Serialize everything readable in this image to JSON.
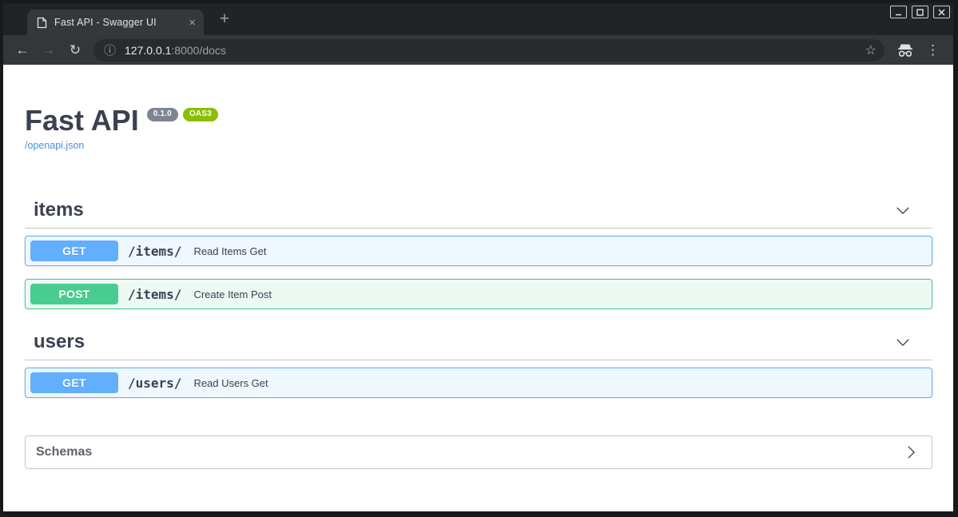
{
  "window": {
    "title_bar": {
      "tab": {
        "title": "Fast API - Swagger UI",
        "close_glyph": "×"
      },
      "new_tab_glyph": "+"
    },
    "toolbar": {
      "back_glyph": "←",
      "forward_glyph": "→",
      "reload_glyph": "↻",
      "omnibox": {
        "info_glyph": "ⓘ",
        "url_host": "127.0.0.1",
        "url_rest": ":8000/docs",
        "star_glyph": "☆"
      },
      "menu_glyph": "⋮"
    }
  },
  "api": {
    "title": "Fast API",
    "version_badge": "0.1.0",
    "oas_badge": "OAS3",
    "spec_link": "/openapi.json",
    "sections": [
      {
        "name": "items",
        "operations": [
          {
            "method": "GET",
            "path": "/items/",
            "summary": "Read Items Get"
          },
          {
            "method": "POST",
            "path": "/items/",
            "summary": "Create Item Post"
          }
        ]
      },
      {
        "name": "users",
        "operations": [
          {
            "method": "GET",
            "path": "/users/",
            "summary": "Read Users Get"
          }
        ]
      }
    ],
    "schemas_label": "Schemas"
  },
  "colors": {
    "get_method": "#61affe",
    "post_method": "#49cc90",
    "version_badge_bg": "#7d8492",
    "oas_badge_bg": "#89bf04",
    "link": "#4990e2",
    "heading_text": "#3b4151"
  }
}
